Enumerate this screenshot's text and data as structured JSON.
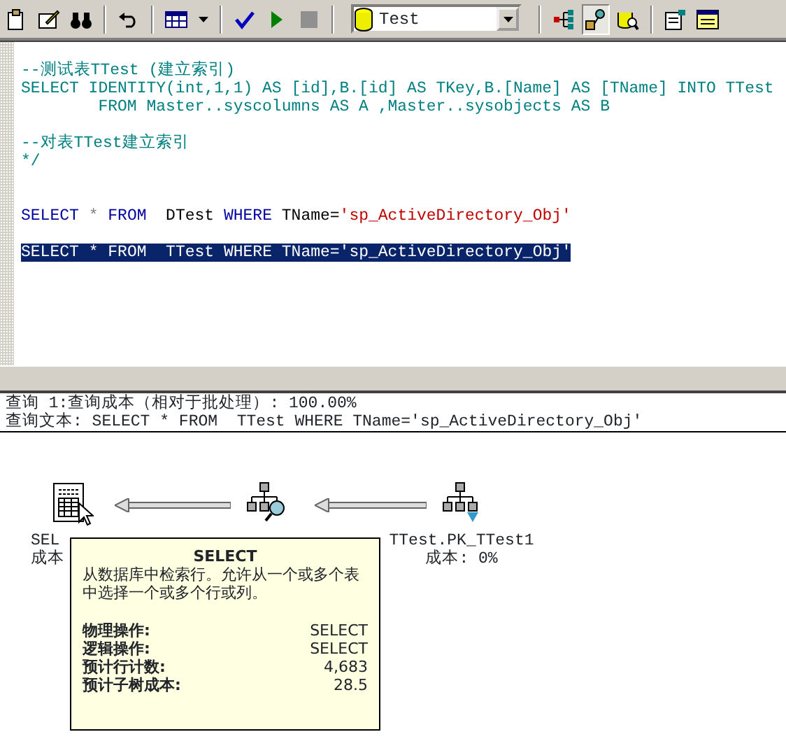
{
  "toolbar": {
    "database": "Test"
  },
  "editor": {
    "lines": [
      {
        "kind": "code",
        "selected": false,
        "segments": [
          {
            "kind": "comment",
            "text": "--测试表TTest (建立索引)"
          }
        ]
      },
      {
        "kind": "code",
        "selected": false,
        "segments": [
          {
            "kind": "comment",
            "text": "SELECT IDENTITY(int,1,1) AS [id],B.[id] AS TKey,B.[Name] AS [TName] INTO TTest"
          }
        ]
      },
      {
        "kind": "code",
        "selected": false,
        "segments": [
          {
            "kind": "comment",
            "text": "        FROM Master..syscolumns AS A ,Master..sysobjects AS B"
          }
        ]
      },
      {
        "kind": "blank"
      },
      {
        "kind": "code",
        "selected": false,
        "segments": [
          {
            "kind": "comment",
            "text": "--对表TTest建立索引"
          }
        ]
      },
      {
        "kind": "code",
        "selected": false,
        "segments": [
          {
            "kind": "comment",
            "text": "*/"
          }
        ]
      },
      {
        "kind": "blank"
      },
      {
        "kind": "blank"
      },
      {
        "kind": "code",
        "selected": false,
        "segments": [
          {
            "kind": "keyword",
            "text": "SELECT"
          },
          {
            "kind": "operator",
            "text": " * "
          },
          {
            "kind": "keyword",
            "text": "FROM"
          },
          {
            "kind": "plain",
            "text": "  DTest "
          },
          {
            "kind": "keyword",
            "text": "WHERE"
          },
          {
            "kind": "plain",
            "text": " TName="
          },
          {
            "kind": "string",
            "text": "'sp_ActiveDirectory_Obj'"
          }
        ]
      },
      {
        "kind": "blank"
      },
      {
        "kind": "code",
        "selected": true,
        "segments": [
          {
            "kind": "keyword",
            "text": "SELECT"
          },
          {
            "kind": "operator",
            "text": " * "
          },
          {
            "kind": "keyword",
            "text": "FROM"
          },
          {
            "kind": "plain",
            "text": "  TTest "
          },
          {
            "kind": "keyword",
            "text": "WHERE"
          },
          {
            "kind": "plain",
            "text": " TName="
          },
          {
            "kind": "string",
            "text": "'sp_ActiveDirectory_Obj'"
          }
        ]
      }
    ]
  },
  "results": {
    "cost_line": "查询 1:查询成本（相对于批处理）: 100.00%",
    "query_line": "查询文本: SELECT * FROM  TTest WHERE TName='sp_ActiveDirectory_Obj'"
  },
  "plan": {
    "nodes": [
      {
        "kind": "select",
        "name": "SEL",
        "cost": "成本"
      },
      {
        "kind": "lookup"
      },
      {
        "kind": "index_scan",
        "name": "TTest.PK_TTest1",
        "cost": "成本: 0%"
      }
    ],
    "tooltip": {
      "title": "SELECT",
      "description": "从数据库中检索行。允许从一个或多个表中选择一个或多个行或列。",
      "rows": [
        {
          "label": "物理操作:",
          "value": "SELECT"
        },
        {
          "label": "逻辑操作:",
          "value": "SELECT"
        },
        {
          "label": "预计行计数:",
          "value": "4,683"
        },
        {
          "label": "预计子树成本:",
          "value": "28.5"
        }
      ]
    }
  }
}
